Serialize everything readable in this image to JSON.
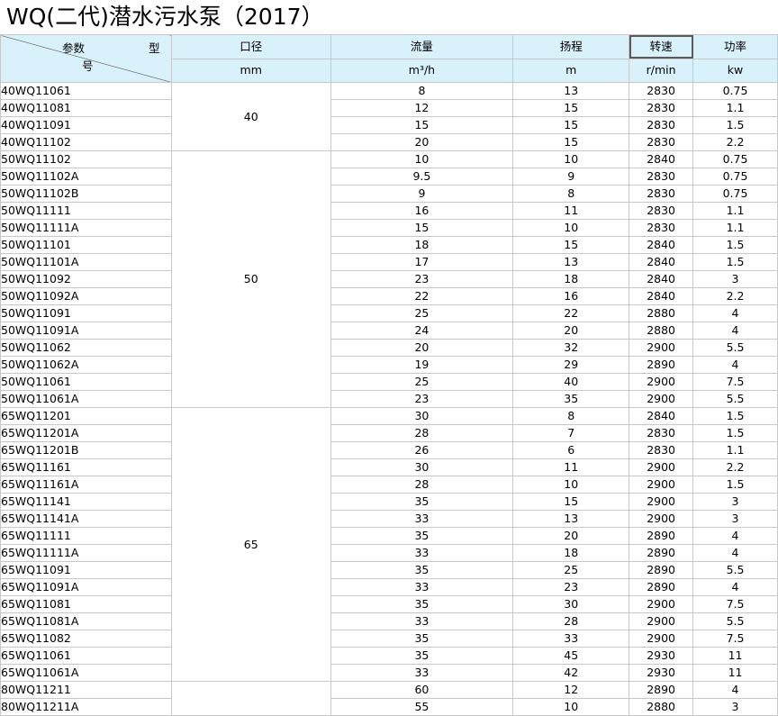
{
  "title": "WQ(二代)潜水污水泵（2017）",
  "header": {
    "corner": {
      "top_left": "参数",
      "top_right": "型",
      "bottom": "号"
    },
    "columns": [
      "口径",
      "流量",
      "扬程",
      "转速",
      "功率"
    ],
    "units": [
      "mm",
      "m³/h",
      "m",
      "r/min",
      "kw"
    ]
  },
  "groups": [
    {
      "diameter": "40",
      "rows": [
        [
          "40WQ11061",
          "8",
          "13",
          "2830",
          "0.75"
        ],
        [
          "40WQ11081",
          "12",
          "15",
          "2830",
          "1.1"
        ],
        [
          "40WQ11091",
          "15",
          "15",
          "2830",
          "1.5"
        ],
        [
          "40WQ11102",
          "20",
          "15",
          "2830",
          "2.2"
        ]
      ]
    },
    {
      "diameter": "50",
      "rows": [
        [
          "50WQ11102",
          "10",
          "10",
          "2840",
          "0.75"
        ],
        [
          "50WQ11102A",
          "9.5",
          "9",
          "2830",
          "0.75"
        ],
        [
          "50WQ11102B",
          "9",
          "8",
          "2830",
          "0.75"
        ],
        [
          "50WQ11111",
          "16",
          "11",
          "2830",
          "1.1"
        ],
        [
          "50WQ11111A",
          "15",
          "10",
          "2830",
          "1.1"
        ],
        [
          "50WQ11101",
          "18",
          "15",
          "2840",
          "1.5"
        ],
        [
          "50WQ11101A",
          "17",
          "13",
          "2840",
          "1.5"
        ],
        [
          "50WQ11092",
          "23",
          "18",
          "2840",
          "3"
        ],
        [
          "50WQ11092A",
          "22",
          "16",
          "2840",
          "2.2"
        ],
        [
          "50WQ11091",
          "25",
          "22",
          "2880",
          "4"
        ],
        [
          "50WQ11091A",
          "24",
          "20",
          "2880",
          "4"
        ],
        [
          "50WQ11062",
          "20",
          "32",
          "2900",
          "5.5"
        ],
        [
          "50WQ11062A",
          "19",
          "29",
          "2890",
          "4"
        ],
        [
          "50WQ11061",
          "25",
          "40",
          "2900",
          "7.5"
        ],
        [
          "50WQ11061A",
          "23",
          "35",
          "2900",
          "5.5"
        ]
      ]
    },
    {
      "diameter": "65",
      "rows": [
        [
          "65WQ11201",
          "30",
          "8",
          "2840",
          "1.5"
        ],
        [
          "65WQ11201A",
          "28",
          "7",
          "2830",
          "1.5"
        ],
        [
          "65WQ11201B",
          "26",
          "6",
          "2830",
          "1.1"
        ],
        [
          "65WQ11161",
          "30",
          "11",
          "2900",
          "2.2"
        ],
        [
          "65WQ11161A",
          "28",
          "10",
          "2900",
          "1.5"
        ],
        [
          "65WQ11141",
          "35",
          "15",
          "2900",
          "3"
        ],
        [
          "65WQ11141A",
          "33",
          "13",
          "2900",
          "3"
        ],
        [
          "65WQ11111",
          "35",
          "20",
          "2890",
          "4"
        ],
        [
          "65WQ11111A",
          "33",
          "18",
          "2890",
          "4"
        ],
        [
          "65WQ11091",
          "35",
          "25",
          "2890",
          "5.5"
        ],
        [
          "65WQ11091A",
          "33",
          "23",
          "2890",
          "4"
        ],
        [
          "65WQ11081",
          "35",
          "30",
          "2900",
          "7.5"
        ],
        [
          "65WQ11081A",
          "33",
          "28",
          "2900",
          "5.5"
        ],
        [
          "65WQ11082",
          "35",
          "33",
          "2900",
          "7.5"
        ],
        [
          "65WQ11061",
          "35",
          "45",
          "2930",
          "11"
        ],
        [
          "65WQ11061A",
          "33",
          "42",
          "2930",
          "11"
        ]
      ]
    },
    {
      "diameter": "",
      "rows": [
        [
          "80WQ11211",
          "60",
          "12",
          "2890",
          "4"
        ],
        [
          "80WQ11211A",
          "55",
          "10",
          "2880",
          "3"
        ]
      ]
    }
  ],
  "selected_header": "转速"
}
